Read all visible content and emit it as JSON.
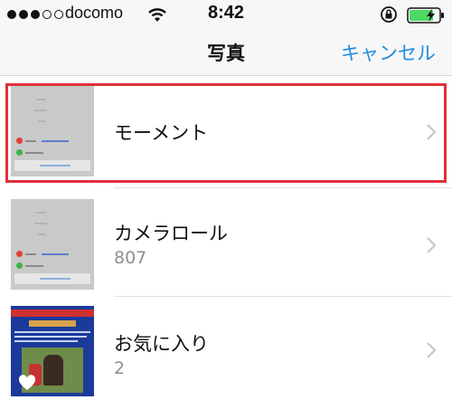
{
  "status_bar": {
    "carrier": "docomo",
    "time": "8:42",
    "signal_icon": "signal-dots-icon",
    "wifi_icon": "wifi-icon",
    "lock_icon": "rotation-lock-icon",
    "battery_icon": "battery-charging-icon"
  },
  "nav": {
    "title": "写真",
    "cancel_label": "キャンセル"
  },
  "albums": [
    {
      "label": "モーメント",
      "count": "",
      "highlighted": true
    },
    {
      "label": "カメラロール",
      "count": "807",
      "highlighted": false
    },
    {
      "label": "お気に入り",
      "count": "2",
      "highlighted": false
    }
  ],
  "colors": {
    "accent": "#1e8ce0",
    "highlight_border": "#e0303a",
    "battery": "#4cd964"
  }
}
